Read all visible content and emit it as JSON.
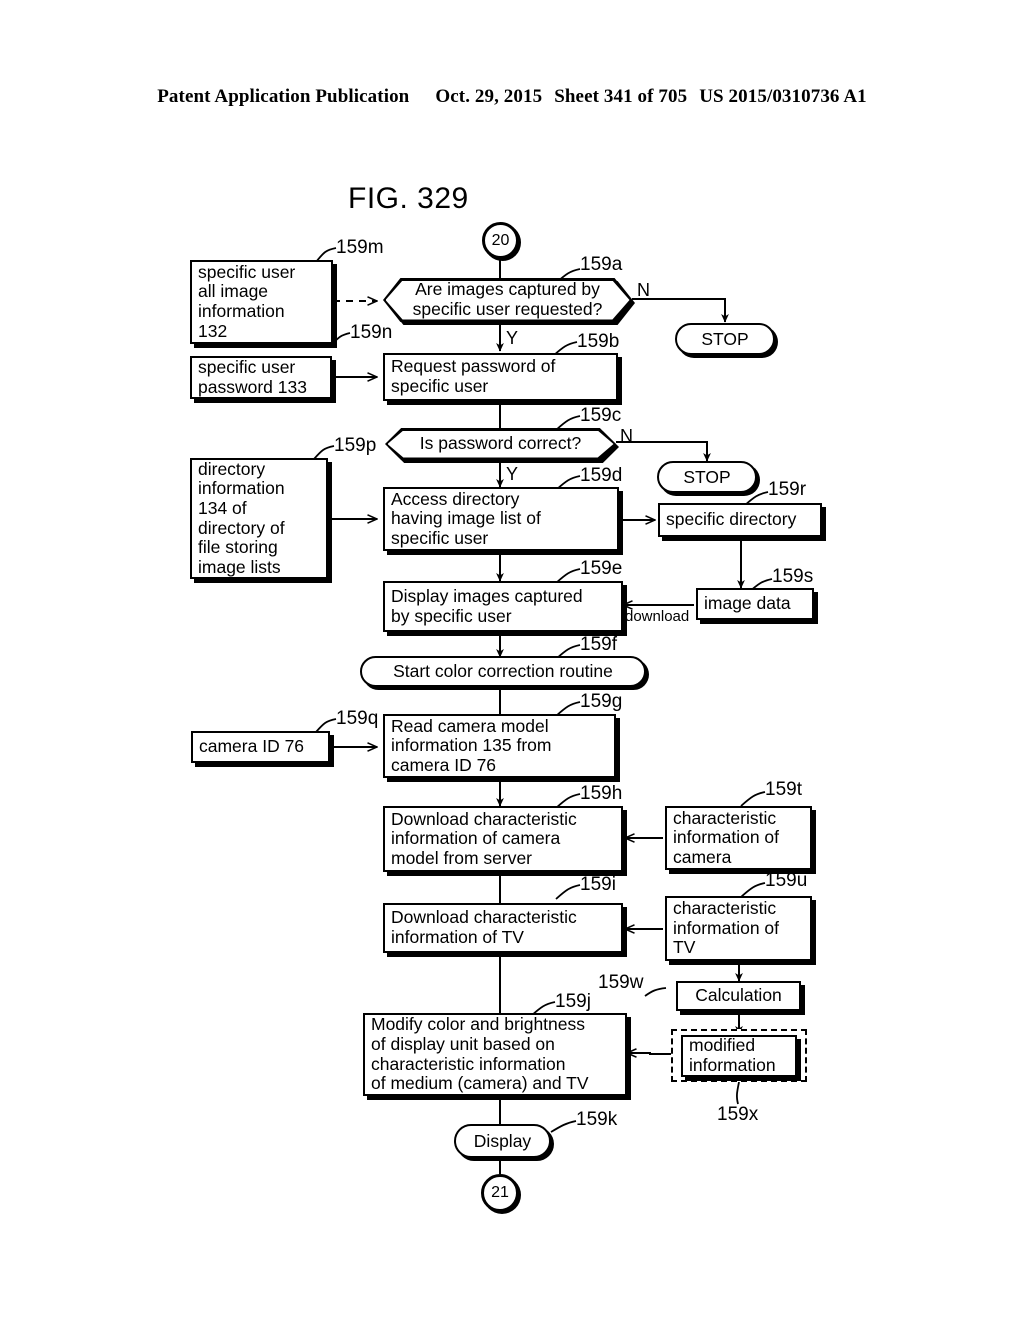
{
  "header": {
    "publication": "Patent Application Publication",
    "date": "Oct. 29, 2015",
    "sheet": "Sheet 341 of 705",
    "docnum": "US 2015/0310736 A1"
  },
  "figure": {
    "title": "FIG. 329"
  },
  "connectors": {
    "entry": "20",
    "exit": "21"
  },
  "nodes": {
    "n159m": {
      "ref": "159m",
      "text": "specific user\nall image\ninformation\n132"
    },
    "n159n": {
      "ref": "159n",
      "text": "specific user\npassword 133"
    },
    "n159p": {
      "ref": "159p",
      "text": "directory\ninformation\n134 of\ndirectory of\nfile storing\nimage lists"
    },
    "n159q": {
      "ref": "159q",
      "text": "camera ID 76"
    },
    "n159a": {
      "ref": "159a",
      "text": "Are images captured by\nspecific user requested?"
    },
    "n159b": {
      "ref": "159b",
      "text": "Request password of\nspecific user"
    },
    "n159c": {
      "ref": "159c",
      "text": "Is password correct?"
    },
    "n159d": {
      "ref": "159d",
      "text": "Access directory\nhaving image list of\nspecific user"
    },
    "n159e": {
      "ref": "159e",
      "text": "Display images captured\nby specific user"
    },
    "n159f": {
      "ref": "159f",
      "text": "Start color correction routine"
    },
    "n159g": {
      "ref": "159g",
      "text": "Read camera model\ninformation 135 from\ncamera ID 76"
    },
    "n159h": {
      "ref": "159h",
      "text": "Download characteristic\ninformation of camera\nmodel from server"
    },
    "n159i": {
      "ref": "159i",
      "text": "Download characteristic\ninformation of TV"
    },
    "n159j": {
      "ref": "159j",
      "text": "Modify color and brightness\nof display unit based on\ncharacteristic information\nof medium (camera) and TV"
    },
    "n159k": {
      "ref": "159k",
      "text": "Display"
    },
    "n159r": {
      "ref": "159r",
      "text": "specific directory"
    },
    "n159s": {
      "ref": "159s",
      "text": "image data"
    },
    "n159t": {
      "ref": "159t",
      "text": "characteristic\ninformation of\ncamera"
    },
    "n159u": {
      "ref": "159u",
      "text": "characteristic\ninformation of\nTV"
    },
    "n159w": {
      "ref": "159w",
      "text": "Calculation"
    },
    "n159x": {
      "ref": "159x",
      "text": "modified\ninformation"
    },
    "stop1": {
      "text": "STOP"
    },
    "stop2": {
      "text": "STOP"
    }
  },
  "edge_labels": {
    "yes1": "Y",
    "no1": "N",
    "yes2": "Y",
    "no2": "N",
    "download": "download"
  },
  "colors": {
    "ink": "#000000",
    "paper": "#ffffff"
  }
}
